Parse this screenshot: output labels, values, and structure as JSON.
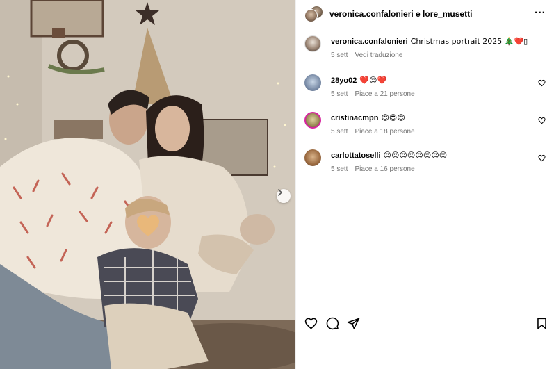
{
  "post": {
    "header_title": "veronica.confalonieri e lore_musetti",
    "image_label": "Family photo"
  },
  "comments": [
    {
      "user": "veronica.confalonieri",
      "text": "Christmas portrait 2025 🎄❤️▯",
      "time": "5 sett",
      "action": "Vedi traduzione"
    },
    {
      "user": "28yo02",
      "text": "❤️😍❤️",
      "time": "5 sett",
      "likes": "Piace a 21 persone"
    },
    {
      "user": "cristinacmpn",
      "text": "😍😍😍",
      "time": "5 sett",
      "likes": "Piace a 18 persone"
    },
    {
      "user": "carlottatoselli",
      "text": "😍😍😍😍😍😍😍😍",
      "time": "5 sett",
      "likes": "Piace a 16 persone"
    }
  ],
  "icons": {
    "more": "more-options-icon",
    "like": "heart-icon",
    "comment": "comment-icon",
    "share": "share-icon",
    "save": "bookmark-icon",
    "next": "chevron-right-icon"
  },
  "colors": {
    "text": "#000000",
    "muted": "#737373",
    "border": "#efefef",
    "story_ring": "#d6249f",
    "heart_red": "#e0245e"
  }
}
